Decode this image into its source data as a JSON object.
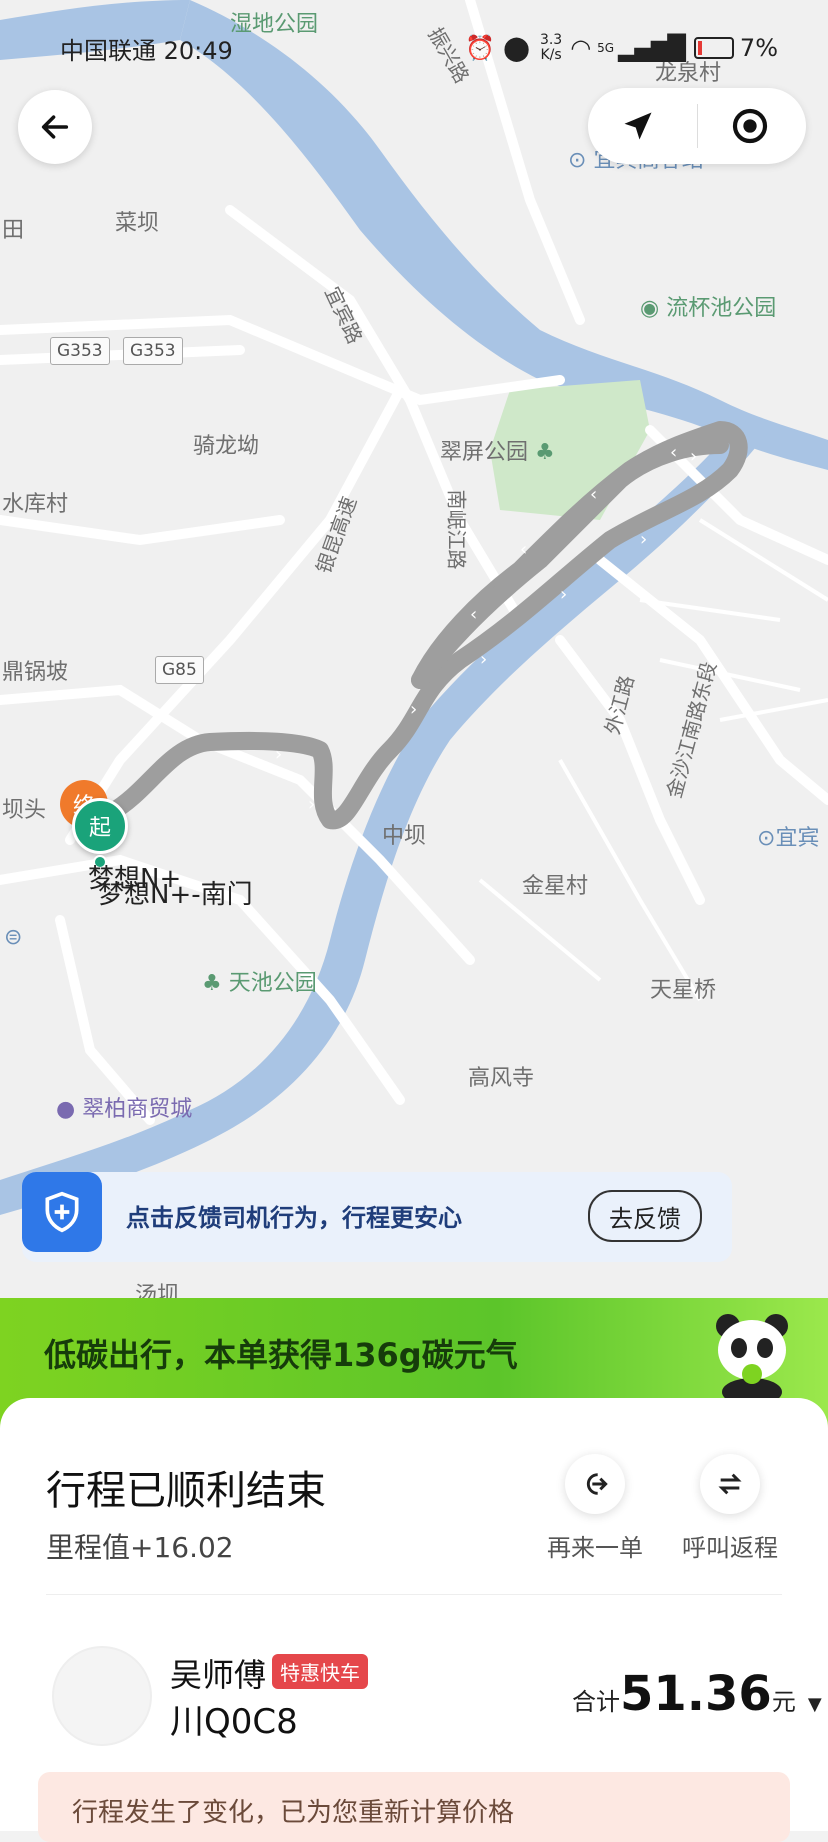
{
  "status_bar": {
    "carrier_time": "中国联通 20:49",
    "net_speed_value": "3.3",
    "net_speed_unit": "K/s",
    "network": "5G",
    "battery": "7%"
  },
  "map": {
    "labels": {
      "l1": "湿地公园",
      "l2": "振兴路",
      "l3": "龙泉村",
      "l4": "宜宾高客站",
      "l5": "田",
      "l6": "菜坝",
      "l7": "宜宾路",
      "l8": "流杯池公园",
      "l9": "骑龙坳",
      "l10": "翠屏公园",
      "l11": "水库村",
      "l12": "银昆高速",
      "l13": "南岷江路",
      "l14": "鼎锅坡",
      "l15": "外江路",
      "l16": "金沙江南路东段",
      "l17": "中坝",
      "l18": "宜宾",
      "l19": "坝头",
      "l20": "金星村",
      "l21": "天池公园",
      "l22": "天星桥",
      "l23": "高风寺",
      "l24": "翠柏商贸城",
      "l25": "汤坝",
      "l26": "梦想N+",
      "l27": "梦想N+-南门"
    },
    "highways": {
      "h1": "G353",
      "h2": "G353",
      "h3": "G85"
    },
    "start_badge": "起",
    "end_badge": "终"
  },
  "feedback_banner": {
    "text": "点击反馈司机行为，行程更安心",
    "button": "去反馈"
  },
  "carbon": {
    "text": "低碳出行，本单获得136g碳元气"
  },
  "trip": {
    "title": "行程已顺利结束",
    "mileage": "里程值+16.02",
    "actions": [
      {
        "label": "再来一单",
        "icon": "reorder-icon"
      },
      {
        "label": "呼叫返程",
        "icon": "return-trip-icon"
      }
    ],
    "driver_name": "吴师傅",
    "driver_badge": "特惠快车",
    "plate": "川Q0C8",
    "total_prefix": "合计",
    "total_amount": "51.36",
    "total_unit": "元",
    "notice": "行程发生了变化，已为您重新计算价格"
  },
  "colors": {
    "route": "#9e9e9e",
    "river": "#a9c4e4",
    "brand_green": "#7ed321",
    "shield_blue": "#2f78e8",
    "badge_red": "#e5474b",
    "start_teal": "#1aa37a",
    "end_orange": "#f07a2b"
  }
}
